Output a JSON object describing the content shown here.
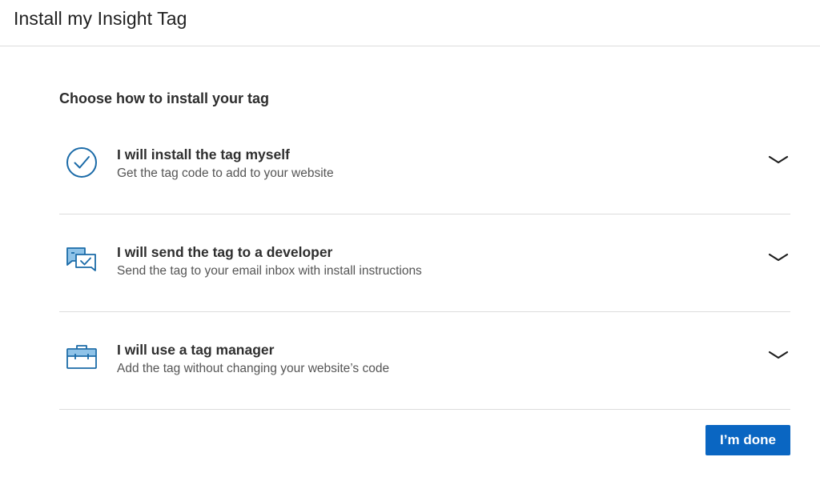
{
  "header": {
    "title": "Install my Insight Tag"
  },
  "main": {
    "section_title": "Choose how to install your tag",
    "options": [
      {
        "title": "I will install the tag myself",
        "description": "Get the tag code to add to your website",
        "icon": "check-circle-icon"
      },
      {
        "title": "I will send the tag to a developer",
        "description": "Send the tag to your email inbox with install instructions",
        "icon": "message-check-icon"
      },
      {
        "title": "I will use a tag manager",
        "description": "Add the tag without changing your website’s code",
        "icon": "briefcase-icon"
      }
    ]
  },
  "footer": {
    "done_label": "I’m done"
  },
  "colors": {
    "primary": "#0a66c2",
    "icon_blue": "#1b6ba8",
    "icon_light_blue": "#8fc3e8"
  }
}
